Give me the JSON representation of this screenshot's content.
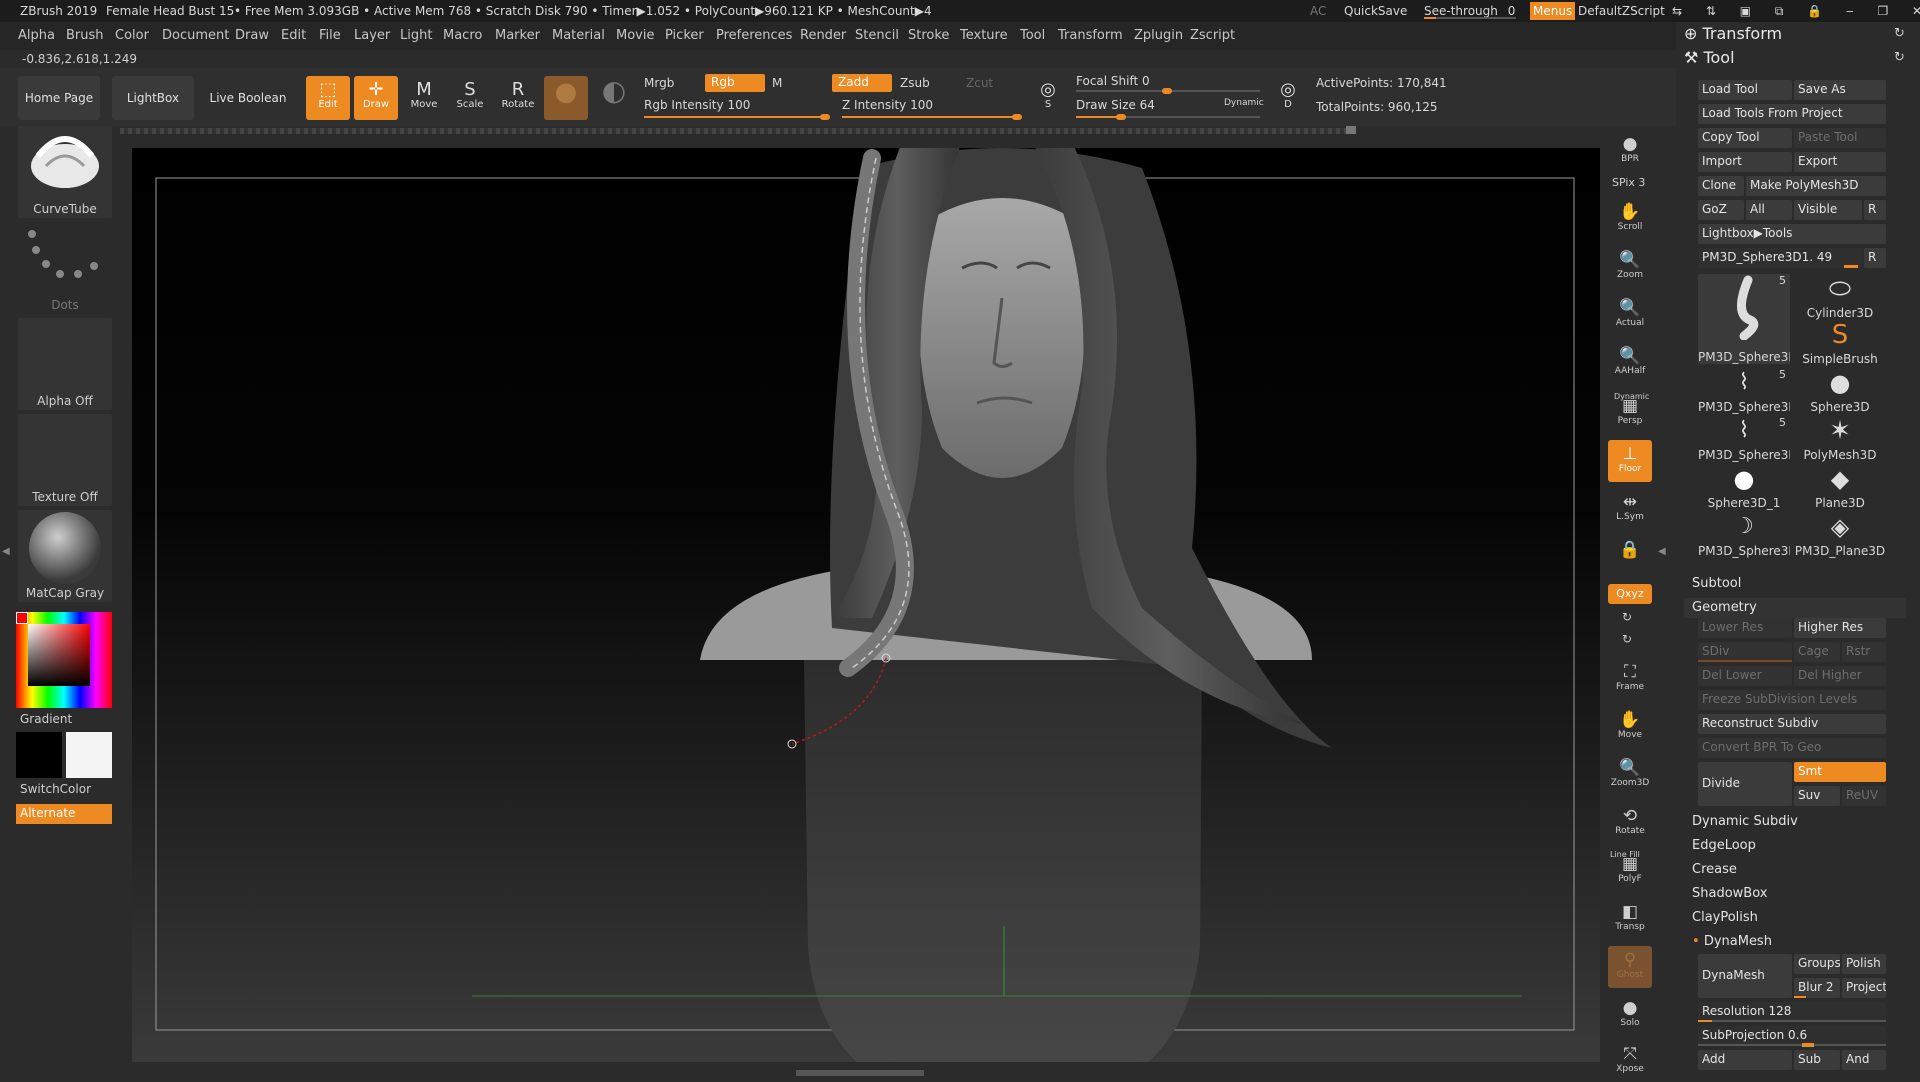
{
  "titlebar": {
    "app": "ZBrush 2019",
    "document": "Female Head Bust 15",
    "stats": "• Free Mem 3.093GB • Active Mem 768 • Scratch Disk 790 • Timer▶1.052 • PolyCount▶960.121 KP • MeshCount▶4",
    "ac": "AC",
    "quicksave": "QuickSave",
    "seethrough_label": "See-through",
    "seethrough_value": "0",
    "menus": "Menus",
    "script": "DefaultZScript"
  },
  "menubar": [
    "Alpha",
    "Brush",
    "Color",
    "Document",
    "Draw",
    "Edit",
    "File",
    "Layer",
    "Light",
    "Macro",
    "Marker",
    "Material",
    "Movie",
    "Picker",
    "Preferences",
    "Render",
    "Stencil",
    "Stroke",
    "Texture",
    "Tool",
    "Transform",
    "Zplugin",
    "Zscript"
  ],
  "coords": "-0.836,2.618,1.249",
  "toolbar": {
    "home": "Home Page",
    "lightbox": "LightBox",
    "live_boolean": "Live Boolean",
    "edit": "Edit",
    "draw": "Draw",
    "move": "Move",
    "scale": "Scale",
    "rotate": "Rotate",
    "mrgb": "Mrgb",
    "rgb": "Rgb",
    "m": "M",
    "zadd": "Zadd",
    "zsub": "Zsub",
    "zcut": "Zcut",
    "rgb_intensity_label": "Rgb Intensity",
    "rgb_intensity": "100",
    "z_intensity_label": "Z Intensity",
    "z_intensity": "100",
    "focal_shift_label": "Focal Shift",
    "focal_shift": "0",
    "draw_size_label": "Draw Size",
    "draw_size": "64",
    "dynamic": "Dynamic",
    "active_points": "ActivePoints: 170,841",
    "total_points": "TotalPoints: 960,125",
    "s_label": "S",
    "d_label": "D"
  },
  "leftshelf": {
    "brush": "CurveTube",
    "stroke": "Dots",
    "alpha": "Alpha Off",
    "texture": "Texture Off",
    "material": "MatCap Gray",
    "gradient": "Gradient",
    "switchcolor": "SwitchColor",
    "alternate": "Alternate"
  },
  "rightshelf": [
    {
      "name": "bpr",
      "label": "BPR"
    },
    {
      "name": "spix",
      "label": "SPix 3"
    },
    {
      "name": "scroll",
      "label": "Scroll"
    },
    {
      "name": "zoom",
      "label": "Zoom"
    },
    {
      "name": "actual",
      "label": "Actual"
    },
    {
      "name": "aahalf",
      "label": "AAHalf"
    },
    {
      "name": "persp",
      "label": "Persp"
    },
    {
      "name": "floor",
      "label": "Floor"
    },
    {
      "name": "lsym",
      "label": "L.Sym"
    },
    {
      "name": "xyz",
      "label": "Qxyz"
    },
    {
      "name": "frame",
      "label": "Frame"
    },
    {
      "name": "move",
      "label": "Move"
    },
    {
      "name": "zoom3d",
      "label": "Zoom3D"
    },
    {
      "name": "rotate",
      "label": "Rotate"
    },
    {
      "name": "polyf",
      "label": "PolyF"
    },
    {
      "name": "transp",
      "label": "Transp"
    },
    {
      "name": "ghost",
      "label": "Ghost"
    },
    {
      "name": "solo",
      "label": "Solo"
    },
    {
      "name": "xpose",
      "label": "Xpose"
    }
  ],
  "rightshelf_extra": {
    "dynamic": "Dynamic",
    "linefill": "Line Fill"
  },
  "rpanel": {
    "transform": "Transform",
    "tool": "Tool",
    "load_tool": "Load Tool",
    "save_as": "Save As",
    "load_from_project": "Load Tools From Project",
    "copy_tool": "Copy Tool",
    "paste_tool": "Paste Tool",
    "import": "Import",
    "export": "Export",
    "clone": "Clone",
    "make_polymesh": "Make PolyMesh3D",
    "goz": "GoZ",
    "all": "All",
    "visible": "Visible",
    "r": "R",
    "lightbox_tools": "Lightbox▶Tools",
    "current_tool": "PM3D_Sphere3D1. 49",
    "tools": [
      {
        "name": "PM3D_Sphere3D",
        "badge": "5"
      },
      {
        "name": "Cylinder3D",
        "badge": ""
      },
      {
        "name": "",
        "badge": ""
      },
      {
        "name": "SimpleBrush",
        "badge": ""
      },
      {
        "name": "PM3D_Sphere3D",
        "badge": "5"
      },
      {
        "name": "Sphere3D",
        "badge": ""
      },
      {
        "name": "PM3D_Sphere3D",
        "badge": "5"
      },
      {
        "name": "PolyMesh3D",
        "badge": ""
      },
      {
        "name": "Sphere3D_1",
        "badge": ""
      },
      {
        "name": "Plane3D",
        "badge": ""
      },
      {
        "name": "PM3D_Sphere3D",
        "badge": ""
      },
      {
        "name": "PM3D_Plane3D",
        "badge": ""
      }
    ],
    "subtool": "Subtool",
    "geometry": "Geometry",
    "lower_res": "Lower Res",
    "higher_res": "Higher Res",
    "sdiv": "SDiv",
    "cage": "Cage",
    "rstr": "Rstr",
    "del_lower": "Del Lower",
    "del_higher": "Del Higher",
    "freeze": "Freeze SubDivision Levels",
    "reconstruct": "Reconstruct Subdiv",
    "convert_bpr": "Convert BPR To Geo",
    "divide": "Divide",
    "smt": "Smt",
    "suv": "Suv",
    "reuv": "ReUV",
    "dynamic_subdiv": "Dynamic Subdiv",
    "edgeloop": "EdgeLoop",
    "crease": "Crease",
    "shadowbox": "ShadowBox",
    "claypolish": "ClayPolish",
    "dynamesh_section": "DynaMesh",
    "dynamesh_btn": "DynaMesh",
    "groups": "Groups",
    "polish": "Polish",
    "blur": "Blur 2",
    "project": "Project",
    "resolution_label": "Resolution",
    "resolution": "128",
    "subprojection_label": "SubProjection",
    "subprojection": "0.6",
    "add": "Add",
    "sub": "Sub",
    "and": "And"
  }
}
